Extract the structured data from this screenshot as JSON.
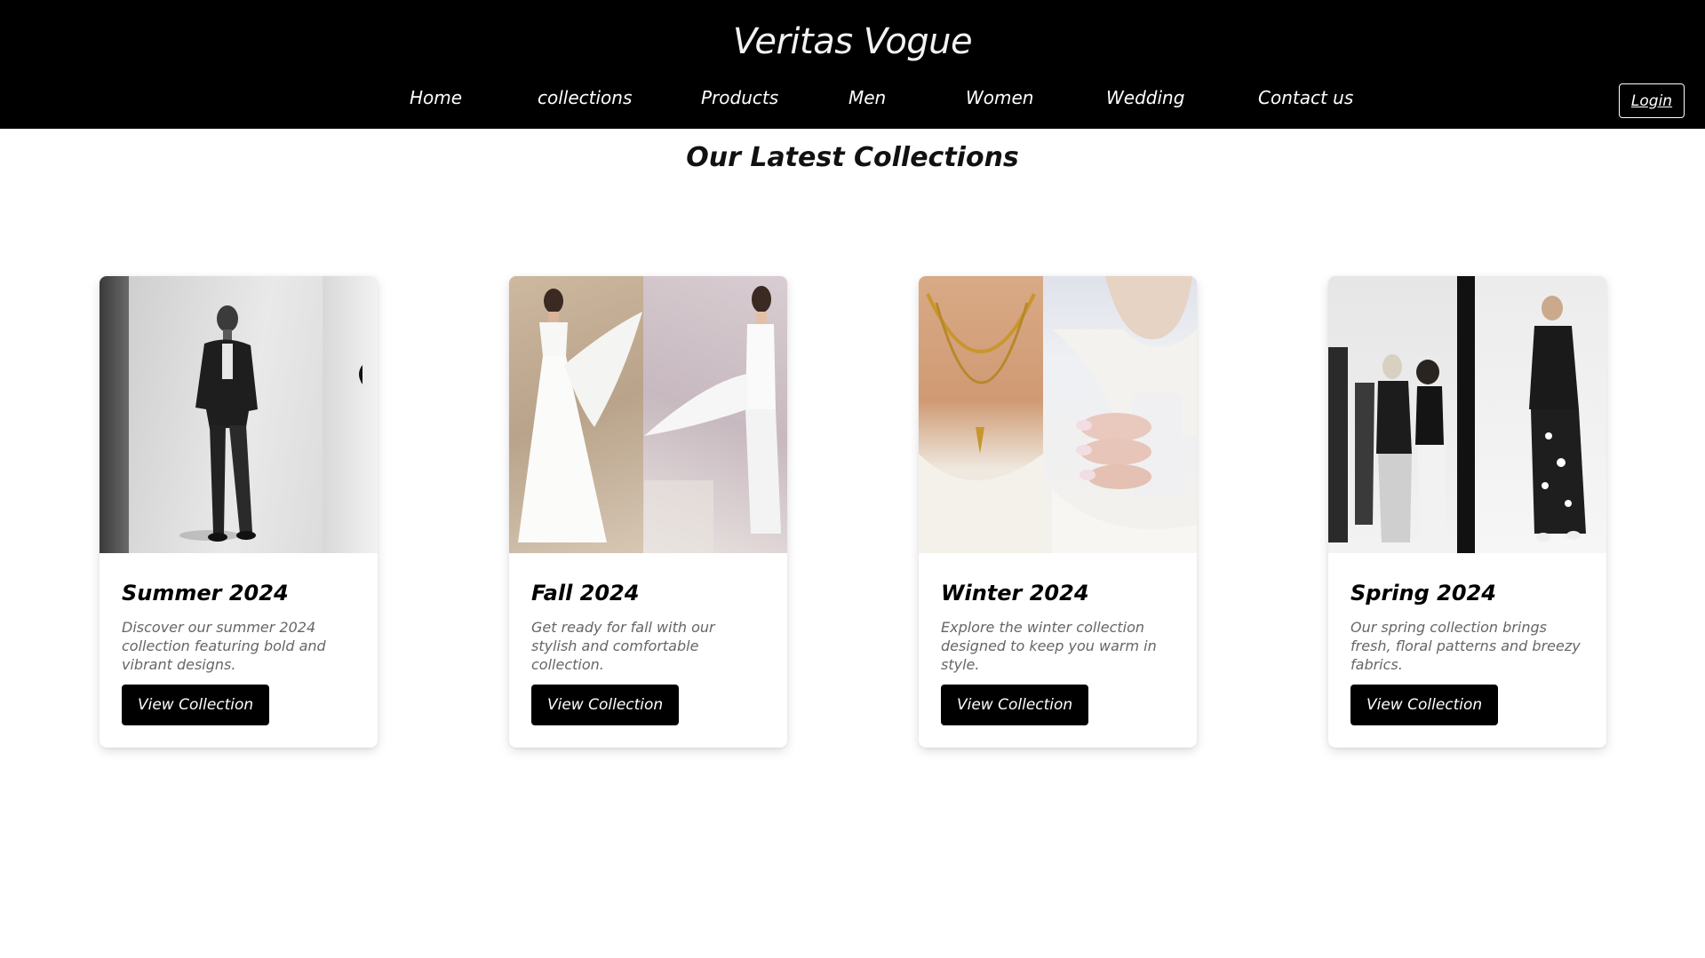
{
  "header": {
    "brand": "Veritas Vogue",
    "nav": [
      {
        "label": "Home"
      },
      {
        "label": "collections"
      },
      {
        "label": "Products"
      },
      {
        "label": "Men"
      },
      {
        "label": "Women"
      },
      {
        "label": "Wedding"
      },
      {
        "label": "Contact us"
      }
    ],
    "login_label": "Login"
  },
  "main": {
    "title": "Our Latest Collections",
    "cards": [
      {
        "title": "Summer 2024",
        "description": "Discover our summer 2024 collection featuring bold and vibrant designs.",
        "button": "View Collection"
      },
      {
        "title": "Fall 2024",
        "description": "Get ready for fall with our stylish and comfortable collection.",
        "button": "View Collection"
      },
      {
        "title": "Winter 2024",
        "description": "Explore the winter collection designed to keep you warm in style.",
        "button": "View Collection"
      },
      {
        "title": "Spring 2024",
        "description": "Our spring collection brings fresh, floral patterns and breezy fabrics.",
        "button": "View Collection"
      }
    ]
  },
  "colors": {
    "header_bg": "#000000",
    "button_bg": "#000000",
    "text_muted": "#666666"
  }
}
